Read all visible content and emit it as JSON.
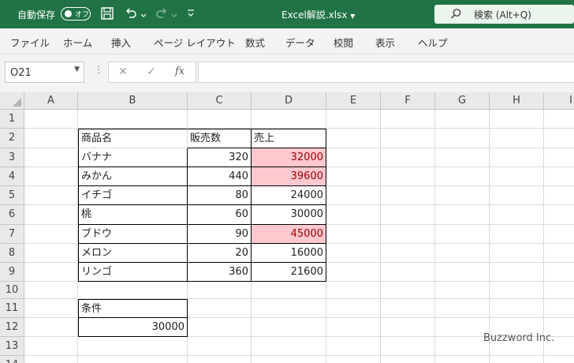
{
  "titlebar": {
    "autosave_label": "自動保存",
    "autosave_state": "オフ",
    "doc_title": "Excel解説.xlsx",
    "search_label": "検索 (Alt+Q)"
  },
  "ribbon_tabs": [
    "ファイル",
    "ホーム",
    "挿入",
    "ページ レイアウト",
    "数式",
    "データ",
    "校閲",
    "表示",
    "ヘルプ"
  ],
  "formula_bar": {
    "name_box": "O21",
    "fx": "fx",
    "value": ""
  },
  "columns": [
    "A",
    "B",
    "C",
    "D",
    "E",
    "F",
    "G",
    "H",
    "I"
  ],
  "rows": [
    "1",
    "2",
    "3",
    "4",
    "5",
    "6",
    "7",
    "8",
    "9",
    "10",
    "11",
    "12",
    "13",
    "14"
  ],
  "table": {
    "headers": [
      "商品名",
      "販売数",
      "売上"
    ],
    "rows": [
      {
        "name": "バナナ",
        "qty": "320",
        "sales": "32000"
      },
      {
        "name": "みかん",
        "qty": "440",
        "sales": "39600"
      },
      {
        "name": "イチゴ",
        "qty": "80",
        "sales": "24000"
      },
      {
        "name": "桃",
        "qty": "60",
        "sales": "30000"
      },
      {
        "name": "ブドウ",
        "qty": "90",
        "sales": "45000"
      },
      {
        "name": "メロン",
        "qty": "20",
        "sales": "16000"
      },
      {
        "name": "リンゴ",
        "qty": "360",
        "sales": "21600"
      }
    ],
    "highlight_fill": "#ffc7ce",
    "highlight_text": "#9c0006"
  },
  "condition": {
    "label": "条件",
    "value": "30000"
  },
  "watermark": "Buzzword Inc.",
  "colors": {
    "title_bar": "#217346",
    "ribbon": "#f3f3f3"
  }
}
